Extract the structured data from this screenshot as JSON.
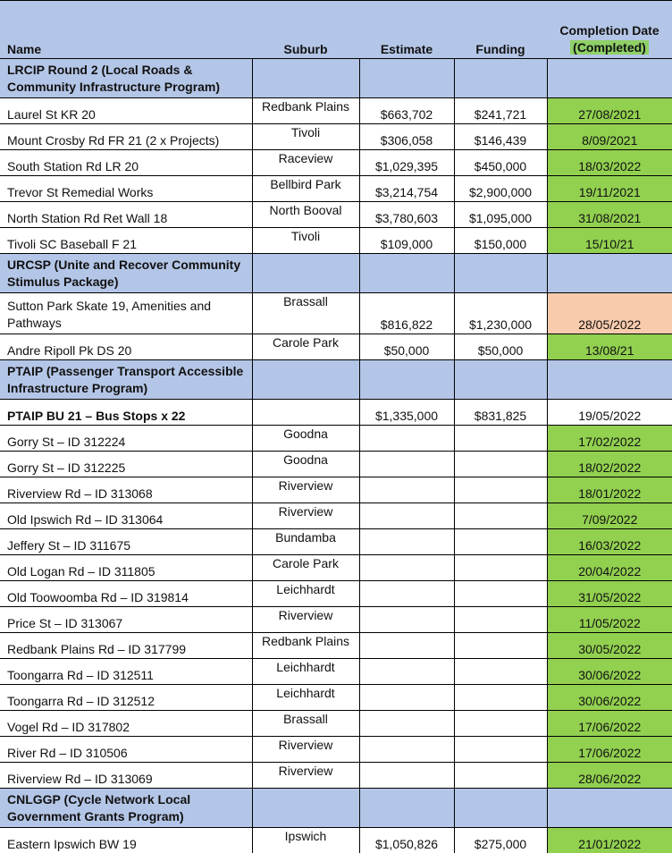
{
  "headers": {
    "name": "Name",
    "suburb": "Suburb",
    "estimate": "Estimate",
    "funding": "Funding",
    "completion_line1": "Completion Date",
    "completion_line2": "(Completed)"
  },
  "colors": {
    "header_blue": "#b4c6e7",
    "completed_green": "#92d050",
    "pending_orange": "#f8cbad"
  },
  "sections": [
    {
      "title": "LRCIP Round 2 (Local Roads & Community Infrastructure Program)",
      "rows": [
        {
          "name": "Laurel St KR 20",
          "suburb": "Redbank Plains",
          "estimate": "$663,702",
          "funding": "$241,721",
          "date": "27/08/2021",
          "status": "green"
        },
        {
          "name": "Mount Crosby Rd FR 21 (2 x Projects)",
          "suburb": "Tivoli",
          "estimate": "$306,058",
          "funding": "$146,439",
          "date": "8/09/2021",
          "status": "green"
        },
        {
          "name": "South Station Rd LR 20",
          "suburb": "Raceview",
          "estimate": "$1,029,395",
          "funding": "$450,000",
          "date": "18/03/2022",
          "status": "green"
        },
        {
          "name": "Trevor St Remedial Works",
          "suburb": "Bellbird Park",
          "estimate": "$3,214,754",
          "funding": "$2,900,000",
          "date": "19/11/2021",
          "status": "green"
        },
        {
          "name": "North Station Rd Ret Wall 18",
          "suburb": "North Booval",
          "estimate": "$3,780,603",
          "funding": "$1,095,000",
          "date": "31/08/2021",
          "status": "green"
        },
        {
          "name": "Tivoli SC Baseball F 21",
          "suburb": "Tivoli",
          "estimate": "$109,000",
          "funding": "$150,000",
          "date": "15/10/21",
          "status": "green"
        }
      ]
    },
    {
      "title": "URCSP (Unite and Recover Community Stimulus Package)",
      "rows": [
        {
          "name": "Sutton Park Skate 19, Amenities and Pathways",
          "suburb": "Brassall",
          "estimate": "$816,822",
          "funding": "$1,230,000",
          "date": "28/05/2022",
          "status": "orange",
          "tall": true
        },
        {
          "name": "Andre Ripoll Pk DS 20",
          "suburb": "Carole Park",
          "estimate": "$50,000",
          "funding": "$50,000",
          "date": "13/08/21",
          "status": "green"
        }
      ]
    },
    {
      "title": "PTAIP (Passenger Transport Accessible Infrastructure Program)",
      "rows": [
        {
          "name": "PTAIP BU 21 – Bus Stops x 22",
          "suburb": "",
          "estimate": "$1,335,000",
          "funding": "$831,825",
          "date": "19/05/2022",
          "status": "none",
          "bold": true
        },
        {
          "name": "Gorry St – ID 312224",
          "suburb": "Goodna",
          "estimate": "",
          "funding": "",
          "date": "17/02/2022",
          "status": "green"
        },
        {
          "name": "Gorry St – ID 312225",
          "suburb": "Goodna",
          "estimate": "",
          "funding": "",
          "date": "18/02/2022",
          "status": "green"
        },
        {
          "name": "Riverview Rd – ID 313068",
          "suburb": "Riverview",
          "estimate": "",
          "funding": "",
          "date": "18/01/2022",
          "status": "green"
        },
        {
          "name": "Old Ipswich Rd – ID 313064",
          "suburb": "Riverview",
          "estimate": "",
          "funding": "",
          "date": "7/09/2022",
          "status": "green"
        },
        {
          "name": "Jeffery St – ID 311675",
          "suburb": "Bundamba",
          "estimate": "",
          "funding": "",
          "date": "16/03/2022",
          "status": "green"
        },
        {
          "name": "Old Logan Rd – ID 311805",
          "suburb": "Carole Park",
          "estimate": "",
          "funding": "",
          "date": "20/04/2022",
          "status": "green"
        },
        {
          "name": "Old Toowoomba Rd – ID 319814",
          "suburb": "Leichhardt",
          "estimate": "",
          "funding": "",
          "date": "31/05/2022",
          "status": "green"
        },
        {
          "name": "Price St – ID 313067",
          "suburb": "Riverview",
          "estimate": "",
          "funding": "",
          "date": "11/05/2022",
          "status": "green"
        },
        {
          "name": "Redbank Plains Rd – ID 317799",
          "suburb": "Redbank Plains",
          "estimate": "",
          "funding": "",
          "date": "30/05/2022",
          "status": "green"
        },
        {
          "name": "Toongarra Rd – ID 312511",
          "suburb": "Leichhardt",
          "estimate": "",
          "funding": "",
          "date": "30/06/2022",
          "status": "green"
        },
        {
          "name": "Toongarra Rd – ID 312512",
          "suburb": "Leichhardt",
          "estimate": "",
          "funding": "",
          "date": "30/06/2022",
          "status": "green"
        },
        {
          "name": "Vogel Rd – ID 317802",
          "suburb": "Brassall",
          "estimate": "",
          "funding": "",
          "date": "17/06/2022",
          "status": "green"
        },
        {
          "name": "River Rd – ID 310506",
          "suburb": "Riverview",
          "estimate": "",
          "funding": "",
          "date": "17/06/2022",
          "status": "green"
        },
        {
          "name": "Riverview Rd – ID 313069",
          "suburb": "Riverview",
          "estimate": "",
          "funding": "",
          "date": "28/06/2022",
          "status": "green"
        }
      ]
    },
    {
      "title": "CNLGGP (Cycle Network Local Government Grants Program)",
      "rows": [
        {
          "name": "Eastern Ipswich BW 19",
          "suburb": "Ipswich",
          "estimate": "$1,050,826",
          "funding": "$275,000",
          "date": "21/01/2022",
          "status": "green"
        }
      ]
    }
  ]
}
